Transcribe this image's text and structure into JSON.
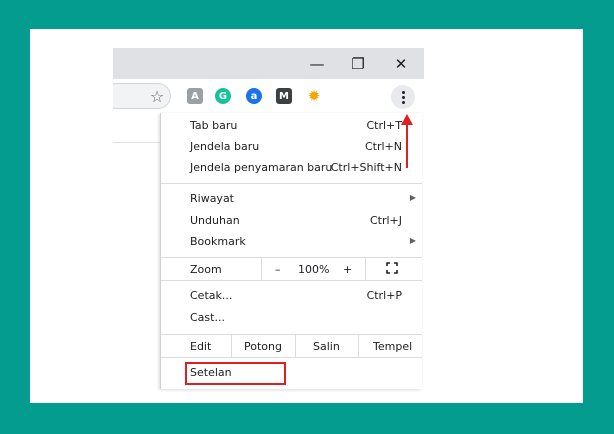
{
  "window": {
    "minimize_glyph": "—",
    "restore_glyph": "❐",
    "close_glyph": "✕"
  },
  "toolbar": {
    "star_glyph": "☆",
    "extensions": [
      {
        "name": "pdf-extension-icon",
        "glyph": "A",
        "color": "#9aa0a6"
      },
      {
        "name": "grammarly-icon",
        "glyph": "G",
        "color": "#15c39a"
      },
      {
        "name": "a-extension-icon",
        "glyph": "a",
        "color": "#1a73e8"
      },
      {
        "name": "m-extension-icon",
        "glyph": "M",
        "color": "#3c4043"
      },
      {
        "name": "sun-extension-icon",
        "glyph": "✹",
        "color": "#f2a600"
      }
    ]
  },
  "menu": {
    "new_tab": {
      "label": "Tab baru",
      "shortcut": "Ctrl+T"
    },
    "new_window": {
      "label": "Jendela baru",
      "shortcut": "Ctrl+N"
    },
    "incognito": {
      "label": "Jendela penyamaran baru",
      "shortcut": "Ctrl+Shift+N"
    },
    "history": {
      "label": "Riwayat"
    },
    "downloads": {
      "label": "Unduhan",
      "shortcut": "Ctrl+J"
    },
    "bookmarks": {
      "label": "Bookmark"
    },
    "zoom": {
      "label": "Zoom",
      "minus": "–",
      "value": "100%",
      "plus": "+"
    },
    "print": {
      "label": "Cetak...",
      "shortcut": "Ctrl+P"
    },
    "cast": {
      "label": "Cast..."
    },
    "edit": {
      "label": "Edit",
      "cut": "Potong",
      "copy": "Salin",
      "paste": "Tempel"
    },
    "settings": {
      "label": "Setelan"
    }
  },
  "colors": {
    "background": "#039c8e",
    "highlight": "#e02020"
  }
}
